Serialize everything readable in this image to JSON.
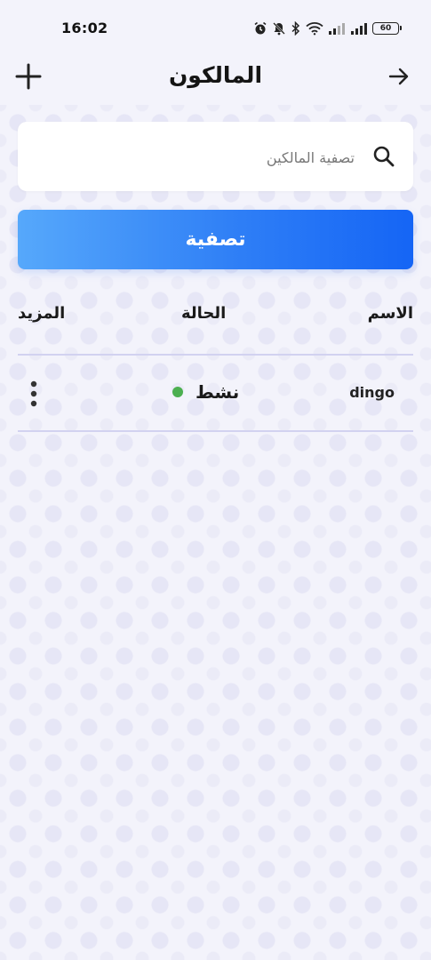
{
  "status_bar": {
    "time": "16:02",
    "battery": "60"
  },
  "header": {
    "title": "المالكون",
    "add_icon": "plus-icon",
    "back_icon": "arrow-right-icon"
  },
  "search": {
    "placeholder": "تصفية المالكين",
    "value": "",
    "icon": "search-icon"
  },
  "filter_button": {
    "label": "تصفية"
  },
  "table": {
    "columns": {
      "name": "الاسم",
      "status": "الحالة",
      "more": "المزيد"
    },
    "rows": [
      {
        "name": "dingo",
        "status": "نشط",
        "status_color": "#4caf50",
        "more_icon": "vertical-dots-icon"
      }
    ]
  },
  "colors": {
    "accent_start": "#56a8fb",
    "accent_end": "#1565f5",
    "background": "#f3f3fb",
    "divider": "#d2d2f0"
  }
}
